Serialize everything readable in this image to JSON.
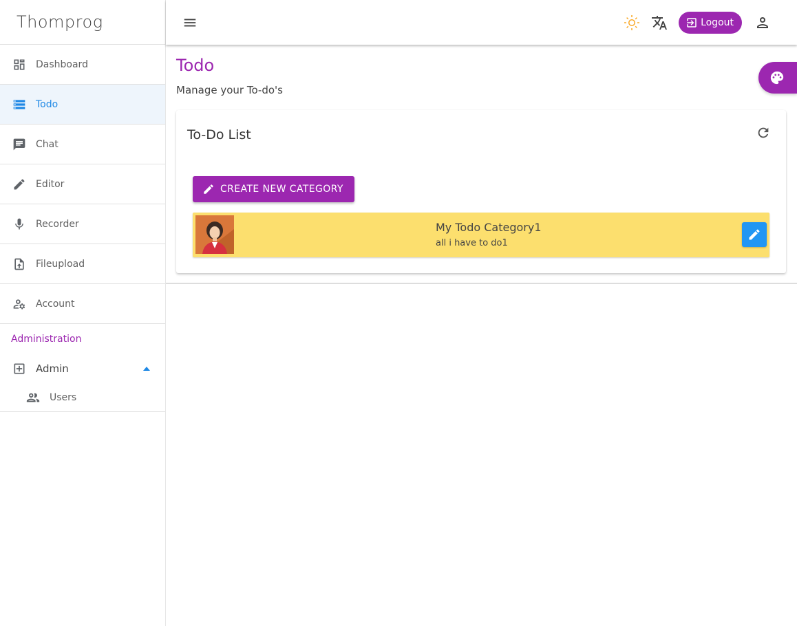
{
  "brand": "Thomprog",
  "sidebar": {
    "items": [
      {
        "label": "Dashboard",
        "icon": "dashboard-icon"
      },
      {
        "label": "Todo",
        "icon": "list-icon",
        "active": true
      },
      {
        "label": "Chat",
        "icon": "chat-icon"
      },
      {
        "label": "Editor",
        "icon": "pencil-icon"
      },
      {
        "label": "Recorder",
        "icon": "microphone-icon"
      },
      {
        "label": "Fileupload",
        "icon": "file-upload-icon"
      },
      {
        "label": "Account",
        "icon": "account-settings-icon"
      }
    ],
    "section_label": "Administration",
    "admin": {
      "label": "Admin",
      "icon": "plus-box-icon"
    },
    "admin_sub": [
      {
        "label": "Users",
        "icon": "users-icon"
      }
    ]
  },
  "topbar": {
    "logout_label": "Logout"
  },
  "page": {
    "title": "Todo",
    "subtitle": "Manage your To-do's"
  },
  "card": {
    "title": "To-Do List",
    "create_label": "CREATE NEW CATEGORY",
    "category": {
      "name": "My Todo Category1",
      "description": "all i have to do1"
    }
  },
  "colors": {
    "accent": "#9c27b0",
    "active_blue": "#1e88e5",
    "category_bg": "#fcdf6e",
    "edit_button": "#2196f3",
    "sun": "#f9a825"
  }
}
